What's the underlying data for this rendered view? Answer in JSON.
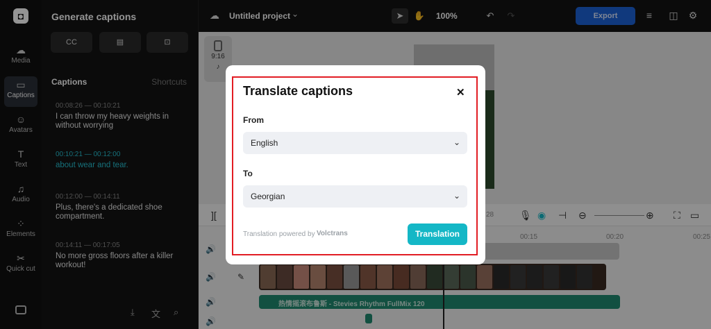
{
  "rail": {
    "items": [
      {
        "label": "Media",
        "icon": "cloud-upload-icon"
      },
      {
        "label": "Captions",
        "icon": "captions-icon"
      },
      {
        "label": "Avatars",
        "icon": "avatar-icon"
      },
      {
        "label": "Text",
        "icon": "text-icon"
      },
      {
        "label": "Audio",
        "icon": "music-note-icon"
      },
      {
        "label": "Elements",
        "icon": "elements-icon"
      },
      {
        "label": "Quick cut",
        "icon": "quick-cut-icon"
      }
    ],
    "active": "Captions"
  },
  "panel": {
    "title": "Generate captions",
    "captions_heading": "Captions",
    "shortcuts_label": "Shortcuts",
    "captions": [
      {
        "time": "00:08:26 — 00:10:21",
        "text": "I can throw my heavy weights in without worrying"
      },
      {
        "time": "00:10:21 — 00:12:00",
        "text": "about wear and tear."
      },
      {
        "time": "00:12:00 — 00:14:11",
        "text": "Plus, there's a dedicated shoe compartment."
      },
      {
        "time": "00:14:11 — 00:17:05",
        "text": "No more gross floors after a killer workout!"
      }
    ]
  },
  "topbar": {
    "project_name": "Untitled project",
    "zoom": "100%",
    "export_label": "Export"
  },
  "canvas": {
    "ratio_label": "9:16"
  },
  "timeline": {
    "current_time": "28",
    "ruler_marks": [
      "00:15",
      "00:20",
      "00:25"
    ],
    "audio_label": "热情摇滚布鲁斯 - Stevies Rhythm FullMix 120"
  },
  "modal": {
    "title": "Translate captions",
    "from_label": "From",
    "from_value": "English",
    "to_label": "To",
    "to_value": "Georgian",
    "powered_by": "Translation powered by",
    "brand": "Volctrans",
    "button_label": "Translation"
  },
  "colors": {
    "accent": "#14b7c6",
    "export": "#1d63d8",
    "highlight": "#e21c23",
    "active_caption": "#27c1d3"
  }
}
